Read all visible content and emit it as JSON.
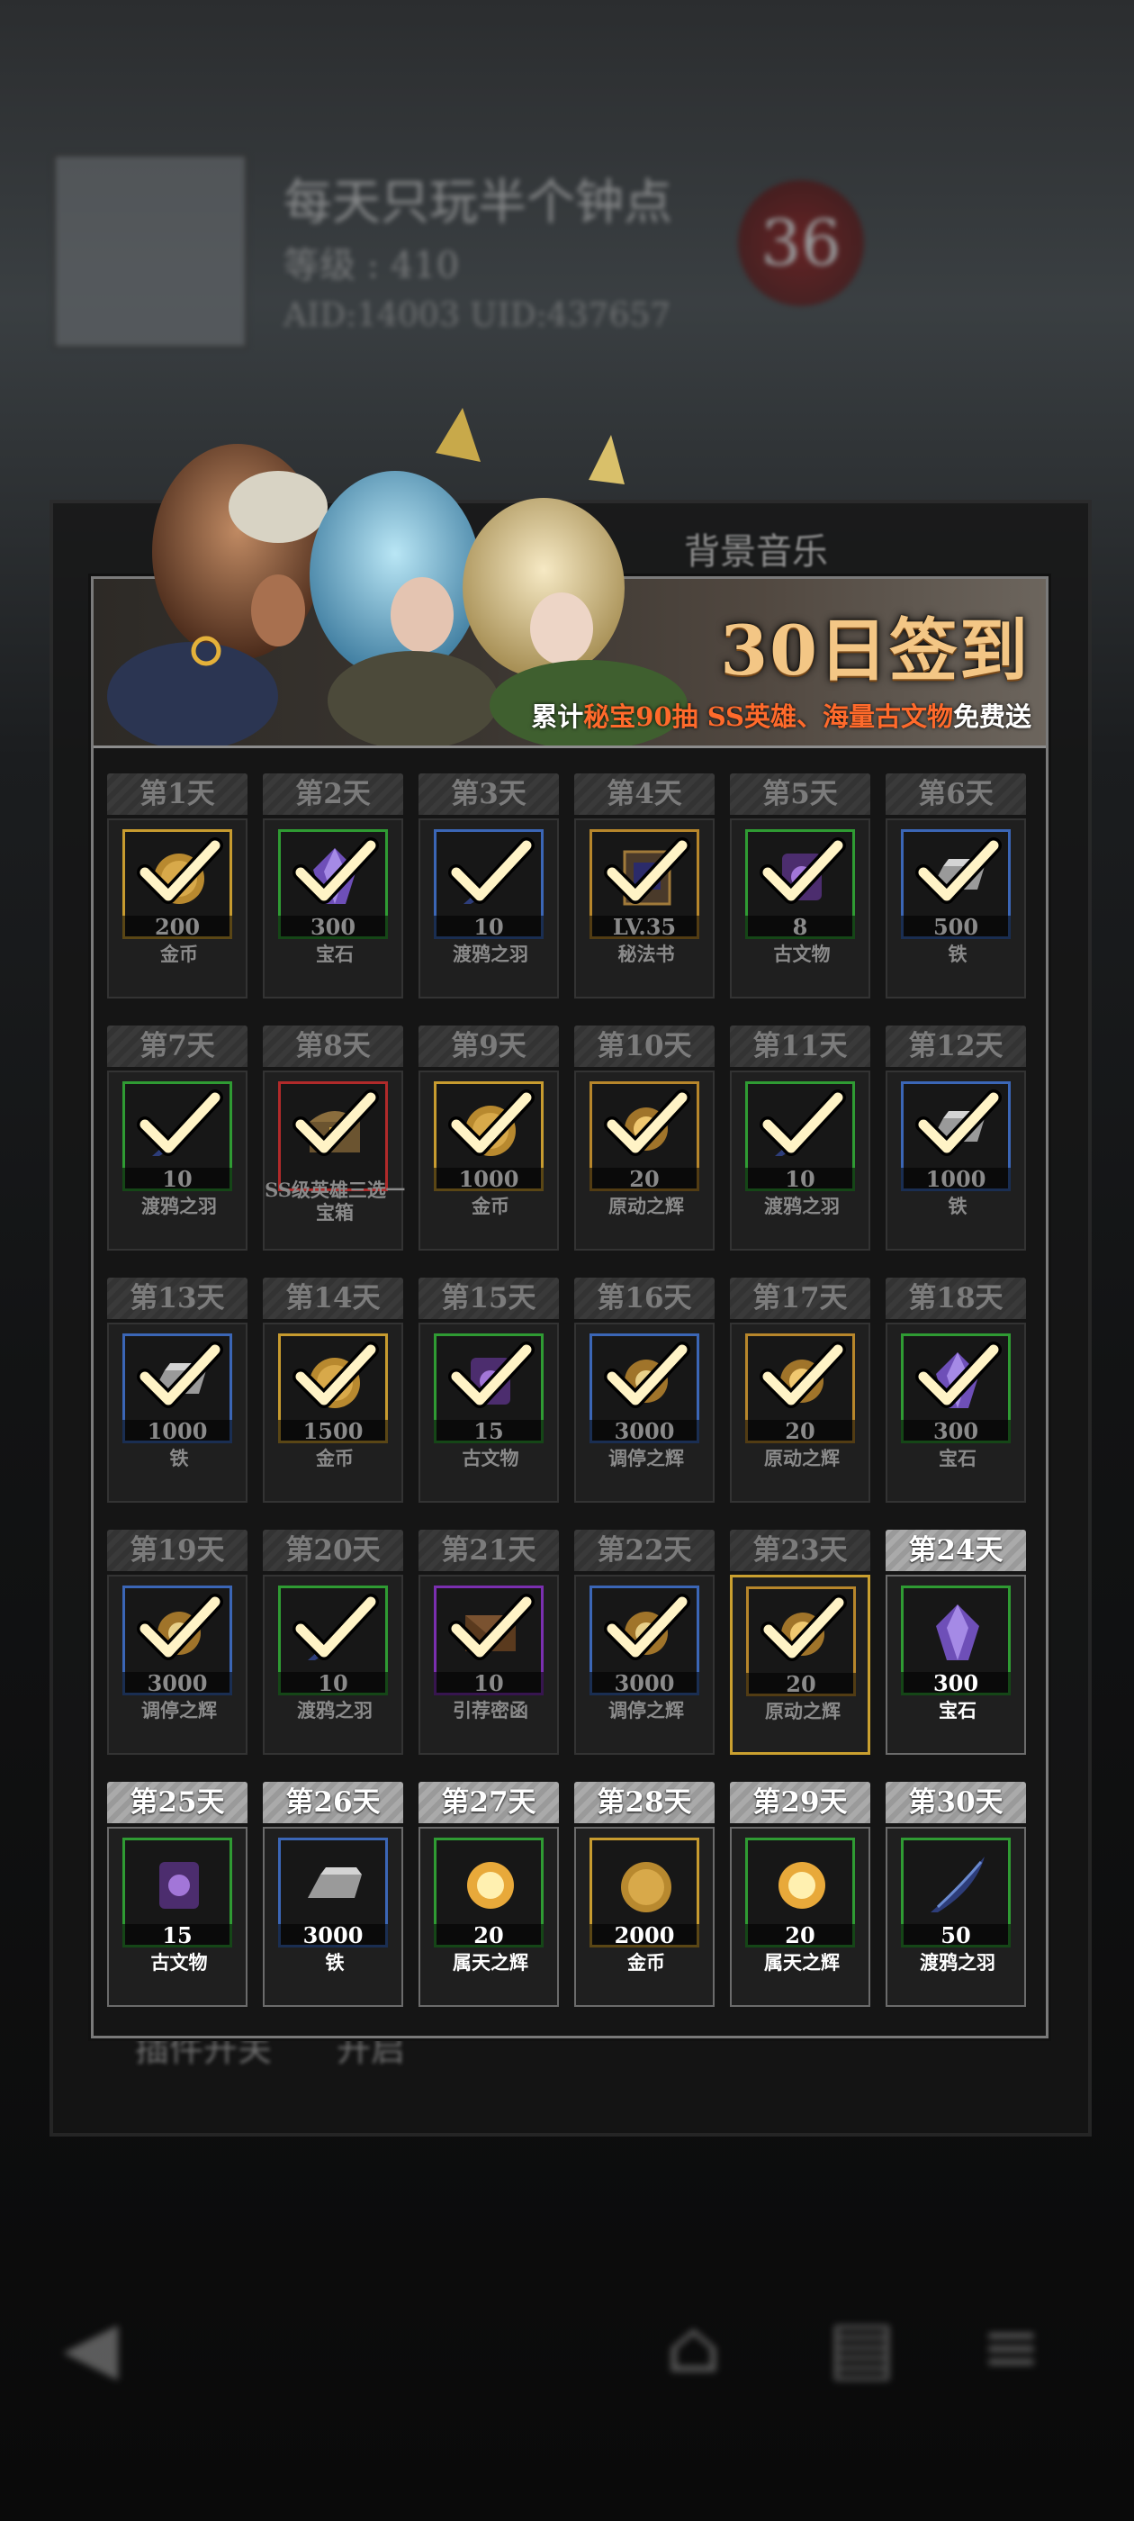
{
  "background": {
    "profile_name": "每天只玩半个钟点",
    "level": "等级 : 410",
    "ids": "AID:14003 UID:437657",
    "badge": "36",
    "tab_label": "背景音乐",
    "switch_label": "插件开关",
    "switch_state": "开启"
  },
  "banner": {
    "title": "30日签到",
    "sub_prefix": "累计",
    "sub_hl1": "秘宝90抽",
    "sub_space": " ",
    "sub_hl2": "SS英雄、海量古文物",
    "sub_suffix": "免费送"
  },
  "days": [
    {
      "label": "第1天",
      "qty": "200",
      "name": "金币",
      "frame": "gold",
      "icon": "coin-icon",
      "claimed": true
    },
    {
      "label": "第2天",
      "qty": "300",
      "name": "宝石",
      "frame": "green",
      "icon": "gem-icon",
      "claimed": true
    },
    {
      "label": "第3天",
      "qty": "10",
      "name": "渡鸦之羽",
      "frame": "blue",
      "icon": "raven-feather-icon",
      "claimed": true
    },
    {
      "label": "第4天",
      "qty": "LV.35",
      "name": "秘法书",
      "frame": "orange",
      "icon": "spellbook-icon",
      "claimed": true
    },
    {
      "label": "第5天",
      "qty": "8",
      "name": "古文物",
      "frame": "green",
      "icon": "artifact-icon",
      "claimed": true
    },
    {
      "label": "第6天",
      "qty": "500",
      "name": "铁",
      "frame": "blue",
      "icon": "iron-ingot-icon",
      "claimed": true
    },
    {
      "label": "第7天",
      "qty": "10",
      "name": "渡鸦之羽",
      "frame": "green",
      "icon": "raven-feather-icon",
      "claimed": true
    },
    {
      "label": "第8天",
      "qty": "",
      "name": "SS级英雄三选一宝箱",
      "frame": "red",
      "icon": "chest-icon",
      "claimed": true
    },
    {
      "label": "第9天",
      "qty": "1000",
      "name": "金币",
      "frame": "gold",
      "icon": "coin-icon",
      "claimed": true
    },
    {
      "label": "第10天",
      "qty": "20",
      "name": "原动之辉",
      "frame": "orange",
      "icon": "radiance-icon",
      "claimed": true
    },
    {
      "label": "第11天",
      "qty": "10",
      "name": "渡鸦之羽",
      "frame": "green",
      "icon": "raven-feather-icon",
      "claimed": true
    },
    {
      "label": "第12天",
      "qty": "1000",
      "name": "铁",
      "frame": "blue",
      "icon": "iron-ingot-icon",
      "claimed": true
    },
    {
      "label": "第13天",
      "qty": "1000",
      "name": "铁",
      "frame": "blue",
      "icon": "iron-ingot-icon",
      "claimed": true
    },
    {
      "label": "第14天",
      "qty": "1500",
      "name": "金币",
      "frame": "gold",
      "icon": "coin-icon",
      "claimed": true
    },
    {
      "label": "第15天",
      "qty": "15",
      "name": "古文物",
      "frame": "green",
      "icon": "artifact-icon",
      "claimed": true
    },
    {
      "label": "第16天",
      "qty": "3000",
      "name": "调停之辉",
      "frame": "blue",
      "icon": "mediation-radiance-icon",
      "claimed": true
    },
    {
      "label": "第17天",
      "qty": "20",
      "name": "原动之辉",
      "frame": "orange",
      "icon": "radiance-icon",
      "claimed": true
    },
    {
      "label": "第18天",
      "qty": "300",
      "name": "宝石",
      "frame": "green",
      "icon": "gem-icon",
      "claimed": true
    },
    {
      "label": "第19天",
      "qty": "3000",
      "name": "调停之辉",
      "frame": "blue",
      "icon": "mediation-radiance-icon",
      "claimed": true
    },
    {
      "label": "第20天",
      "qty": "10",
      "name": "渡鸦之羽",
      "frame": "green",
      "icon": "raven-feather-icon",
      "claimed": true
    },
    {
      "label": "第21天",
      "qty": "10",
      "name": "引荐密函",
      "frame": "purple",
      "icon": "letter-icon",
      "claimed": true
    },
    {
      "label": "第22天",
      "qty": "3000",
      "name": "调停之辉",
      "frame": "blue",
      "icon": "mediation-radiance-icon",
      "claimed": true
    },
    {
      "label": "第23天",
      "qty": "20",
      "name": "原动之辉",
      "frame": "orange",
      "icon": "radiance-icon",
      "claimed": true,
      "current": true
    },
    {
      "label": "第24天",
      "qty": "300",
      "name": "宝石",
      "frame": "green",
      "icon": "gem-icon",
      "claimed": false
    },
    {
      "label": "第25天",
      "qty": "15",
      "name": "古文物",
      "frame": "green",
      "icon": "artifact-icon",
      "claimed": false
    },
    {
      "label": "第26天",
      "qty": "3000",
      "name": "铁",
      "frame": "blue",
      "icon": "iron-ingot-icon",
      "claimed": false
    },
    {
      "label": "第27天",
      "qty": "20",
      "name": "属天之辉",
      "frame": "green",
      "icon": "celestial-radiance-icon",
      "claimed": false
    },
    {
      "label": "第28天",
      "qty": "2000",
      "name": "金币",
      "frame": "gold",
      "icon": "coin-icon",
      "claimed": false
    },
    {
      "label": "第29天",
      "qty": "20",
      "name": "属天之辉",
      "frame": "green",
      "icon": "celestial-radiance-icon",
      "claimed": false
    },
    {
      "label": "第30天",
      "qty": "50",
      "name": "渡鸦之羽",
      "frame": "green",
      "icon": "raven-feather-icon",
      "claimed": false
    }
  ]
}
